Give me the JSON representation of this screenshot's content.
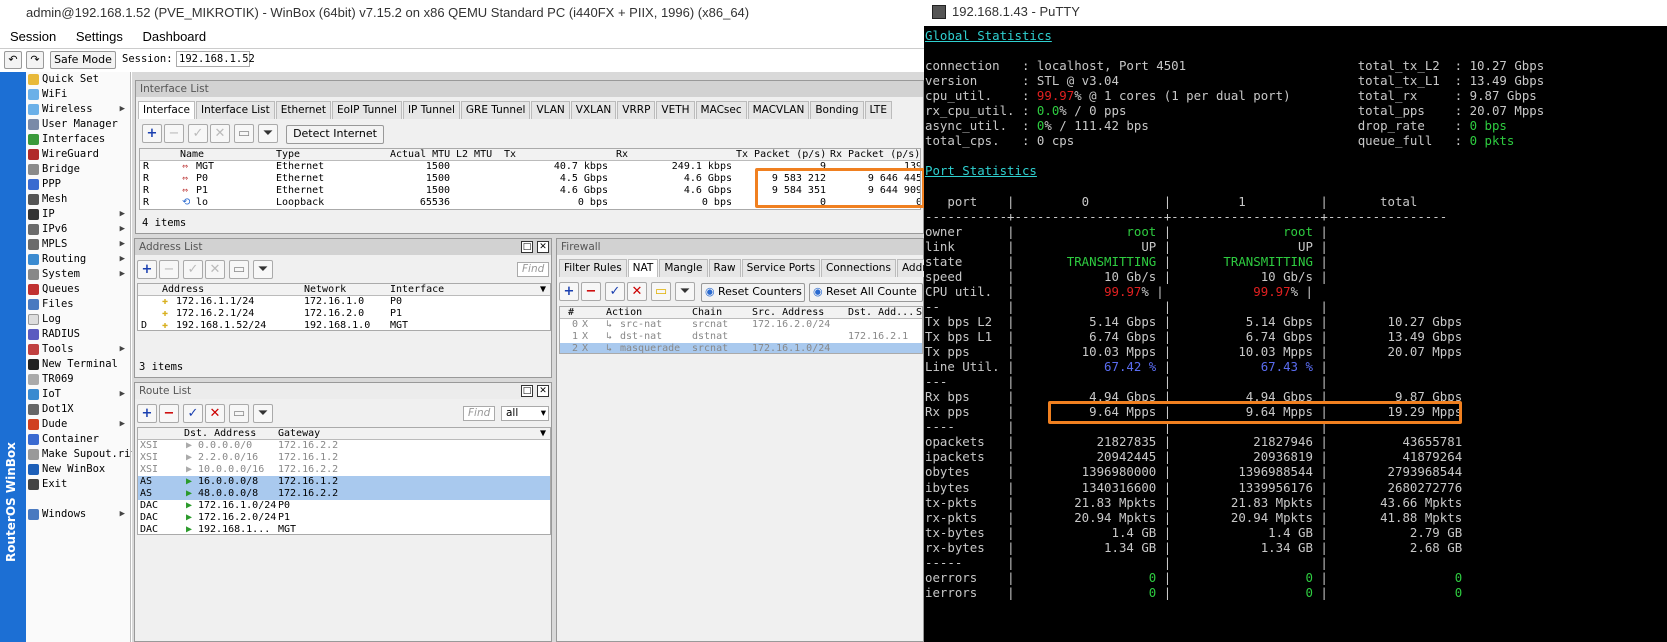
{
  "winbox": {
    "title": "admin@192.168.1.52 (PVE_MIKROTIK) - WinBox (64bit) v7.15.2 on x86 QEMU Standard PC (i440FX + PIIX, 1996) (x86_64)",
    "menu": [
      "Session",
      "Settings",
      "Dashboard"
    ],
    "safe_mode": "Safe Mode",
    "session_label": "Session:",
    "session_value": "192.168.1.52",
    "strip_label": "RouterOS WinBox",
    "sidebar": [
      "Quick Set",
      "WiFi",
      "Wireless",
      "User Manager",
      "Interfaces",
      "WireGuard",
      "Bridge",
      "PPP",
      "Mesh",
      "IP",
      "IPv6",
      "MPLS",
      "Routing",
      "System",
      "Queues",
      "Files",
      "Log",
      "RADIUS",
      "Tools",
      "New Terminal",
      "TR069",
      "IoT",
      "Dot1X",
      "Dude",
      "Container",
      "Make Supout.rif",
      "New WinBox",
      "Exit",
      "Windows"
    ],
    "interface_list": {
      "title": "Interface List",
      "tabs": [
        "Interface",
        "Interface List",
        "Ethernet",
        "EoIP Tunnel",
        "IP Tunnel",
        "GRE Tunnel",
        "VLAN",
        "VXLAN",
        "VRRP",
        "VETH",
        "MACsec",
        "MACVLAN",
        "Bonding",
        "LTE"
      ],
      "detect": "Detect Internet",
      "headers": [
        "Name",
        "Type",
        "Actual MTU",
        "L2 MTU",
        "Tx",
        "Rx",
        "Tx Packet (p/s)",
        "Rx Packet (p/s)"
      ],
      "rows": [
        {
          "flag": "R",
          "name": "MGT",
          "type": "Ethernet",
          "mtu": "1500",
          "l2": "",
          "tx": "40.7 kbps",
          "rx": "249.1 kbps",
          "txp": "9",
          "rxp": "139"
        },
        {
          "flag": "R",
          "name": "P0",
          "type": "Ethernet",
          "mtu": "1500",
          "l2": "",
          "tx": "4.5 Gbps",
          "rx": "4.6 Gbps",
          "txp": "9 583 212",
          "rxp": "9 646 445"
        },
        {
          "flag": "R",
          "name": "P1",
          "type": "Ethernet",
          "mtu": "1500",
          "l2": "",
          "tx": "4.6 Gbps",
          "rx": "4.6 Gbps",
          "txp": "9 584 351",
          "rxp": "9 644 909"
        },
        {
          "flag": "R",
          "name": "lo",
          "type": "Loopback",
          "mtu": "65536",
          "l2": "",
          "tx": "0 bps",
          "rx": "0 bps",
          "txp": "0",
          "rxp": "0"
        }
      ],
      "footer": "4 items"
    },
    "address_list": {
      "title": "Address List",
      "find": "Find",
      "headers": [
        "Address",
        "Network",
        "Interface"
      ],
      "rows": [
        {
          "flag": "",
          "address": "172.16.1.1/24",
          "network": "172.16.1.0",
          "iface": "P0"
        },
        {
          "flag": "",
          "address": "172.16.2.1/24",
          "network": "172.16.2.0",
          "iface": "P1"
        },
        {
          "flag": "D",
          "address": "192.168.1.52/24",
          "network": "192.168.1.0",
          "iface": "MGT"
        }
      ],
      "footer": "3 items"
    },
    "route_list": {
      "title": "Route List",
      "find": "Find",
      "filter": "all",
      "headers": [
        "Dst. Address",
        "Gateway"
      ],
      "rows": [
        {
          "flag": "XSI",
          "dst": "0.0.0.0/0",
          "gw": "172.16.2.2",
          "style": "gray"
        },
        {
          "flag": "XSI",
          "dst": "2.2.0.0/16",
          "gw": "172.16.1.2",
          "style": "gray"
        },
        {
          "flag": "XSI",
          "dst": "10.0.0.0/16",
          "gw": "172.16.2.2",
          "style": "gray"
        },
        {
          "flag": "AS",
          "dst": "16.0.0.0/8",
          "gw": "172.16.1.2",
          "style": "sel"
        },
        {
          "flag": "AS",
          "dst": "48.0.0.0/8",
          "gw": "172.16.2.2",
          "style": "sel"
        },
        {
          "flag": "DAC",
          "dst": "172.16.1.0/24",
          "gw": "P0",
          "style": ""
        },
        {
          "flag": "DAC",
          "dst": "172.16.2.0/24",
          "gw": "P1",
          "style": ""
        },
        {
          "flag": "DAC",
          "dst": "192.168.1...",
          "gw": "MGT",
          "style": ""
        }
      ]
    },
    "firewall": {
      "title": "Firewall",
      "tabs": [
        "Filter Rules",
        "NAT",
        "Mangle",
        "Raw",
        "Service Ports",
        "Connections",
        "Addr"
      ],
      "reset": "Reset Counters",
      "reset_all": "Reset All Counte",
      "headers": [
        "#",
        "Action",
        "Chain",
        "Src. Address",
        "Dst. Add...",
        "S"
      ],
      "rows": [
        {
          "n": "0",
          "x": "X",
          "action": "src-nat",
          "chain": "srcnat",
          "src": "172.16.2.0/24",
          "dst": "",
          "style": ""
        },
        {
          "n": "1",
          "x": "X",
          "action": "dst-nat",
          "chain": "dstnat",
          "src": "",
          "dst": "172.16.2.1",
          "style": ""
        },
        {
          "n": "2",
          "x": "X",
          "action": "masquerade",
          "chain": "srcnat",
          "src": "172.16.1.0/24",
          "dst": "",
          "style": "sel"
        }
      ]
    }
  },
  "putty": {
    "title": "192.168.1.43 - PuTTY",
    "global_heading": "Global Statistics",
    "global_left": [
      {
        "k": "connection   ",
        "v": ": localhost, Port 4501"
      },
      {
        "k": "version      ",
        "v": ": STL @ v3.04"
      },
      {
        "k": "cpu_util.    ",
        "pre": ": ",
        "red": "99.97",
        "v": "% @ 1 cores (1 per dual port)"
      },
      {
        "k": "rx_cpu_util. ",
        "pre": ": ",
        "green": "0.0",
        "v": "% / 0 pps"
      },
      {
        "k": "async_util.  ",
        "pre": ": ",
        "green": "0",
        "v": "% / 111.42 bps"
      },
      {
        "k": "total_cps.   ",
        "v": ": 0 cps"
      }
    ],
    "global_right": [
      {
        "k": "total_tx_L2  ",
        "v": ": 10.27 Gbps"
      },
      {
        "k": "total_tx_L1  ",
        "v": ": 13.49 Gbps"
      },
      {
        "k": "total_rx     ",
        "v": ": 9.87 Gbps"
      },
      {
        "k": "total_pps    ",
        "v": ": 20.07 Mpps"
      },
      {
        "k": "drop_rate    ",
        "pre": ": ",
        "green": "0 bps",
        "v": ""
      },
      {
        "k": "queue_full   ",
        "pre": ": ",
        "green": "0 pkts",
        "v": ""
      }
    ],
    "port_heading": "Port Statistics",
    "port_header": "   port    |         0          |         1          |       total",
    "port_sep": "-----------+--------------------+--------------------+----------------",
    "port_rows": [
      {
        "label": "owner",
        "c0": "root",
        "c1": "root",
        "tot": "",
        "color": "green"
      },
      {
        "label": "link",
        "c0": "UP",
        "c1": "UP",
        "tot": "",
        "color": ""
      },
      {
        "label": "state",
        "c0": "TRANSMITTING",
        "c1": "TRANSMITTING",
        "tot": "",
        "color": "green"
      },
      {
        "label": "speed",
        "c0": "10 Gb/s",
        "c1": "10 Gb/s",
        "tot": "",
        "color": ""
      },
      {
        "label": "CPU util.",
        "c0": "99.97",
        "c1": "99.97",
        "tot": "",
        "color": "cpu"
      },
      {
        "label": "--",
        "c0": "",
        "c1": "",
        "tot": "",
        "color": ""
      },
      {
        "label": "Tx bps L2",
        "c0": "5.14 Gbps",
        "c1": "5.14 Gbps",
        "tot": "10.27 Gbps",
        "color": ""
      },
      {
        "label": "Tx bps L1",
        "c0": "6.74 Gbps",
        "c1": "6.74 Gbps",
        "tot": "13.49 Gbps",
        "color": ""
      },
      {
        "label": "Tx pps",
        "c0": "10.03 Mpps",
        "c1": "10.03 Mpps",
        "tot": "20.07 Mpps",
        "color": ""
      },
      {
        "label": "Line Util.",
        "c0": "67.42 %",
        "c1": "67.43 %",
        "tot": "",
        "color": "blue"
      },
      {
        "label": "---",
        "c0": "",
        "c1": "",
        "tot": "",
        "color": ""
      },
      {
        "label": "Rx bps",
        "c0": "4.94 Gbps",
        "c1": "4.94 Gbps",
        "tot": "9.87 Gbps",
        "color": ""
      },
      {
        "label": "Rx pps",
        "c0": "9.64 Mpps",
        "c1": "9.64 Mpps",
        "tot": "19.29 Mpps",
        "color": ""
      },
      {
        "label": "----",
        "c0": "",
        "c1": "",
        "tot": "",
        "color": ""
      },
      {
        "label": "opackets",
        "c0": "21827835",
        "c1": "21827946",
        "tot": "43655781",
        "color": ""
      },
      {
        "label": "ipackets",
        "c0": "20942445",
        "c1": "20936819",
        "tot": "41879264",
        "color": ""
      },
      {
        "label": "obytes",
        "c0": "1396980000",
        "c1": "1396988544",
        "tot": "2793968544",
        "color": ""
      },
      {
        "label": "ibytes",
        "c0": "1340316600",
        "c1": "1339956176",
        "tot": "2680272776",
        "color": ""
      },
      {
        "label": "tx-pkts",
        "c0": "21.83 Mpkts",
        "c1": "21.83 Mpkts",
        "tot": "43.66 Mpkts",
        "color": ""
      },
      {
        "label": "rx-pkts",
        "c0": "20.94 Mpkts",
        "c1": "20.94 Mpkts",
        "tot": "41.88 Mpkts",
        "color": ""
      },
      {
        "label": "tx-bytes",
        "c0": "1.4 GB",
        "c1": "1.4 GB",
        "tot": "2.79 GB",
        "color": ""
      },
      {
        "label": "rx-bytes",
        "c0": "1.34 GB",
        "c1": "1.34 GB",
        "tot": "2.68 GB",
        "color": ""
      },
      {
        "label": "-----",
        "c0": "",
        "c1": "",
        "tot": "",
        "color": ""
      },
      {
        "label": "oerrors",
        "c0": "0",
        "c1": "0",
        "tot": "0",
        "color": "green"
      },
      {
        "label": "ierrors",
        "c0": "0",
        "c1": "0",
        "tot": "0",
        "color": "green"
      }
    ],
    "colors": {
      "cyan": "#2fd0d0",
      "red": "#e02020",
      "green": "#2ecc40",
      "blue": "#5a6cf0",
      "highlight": "#f08020"
    }
  }
}
